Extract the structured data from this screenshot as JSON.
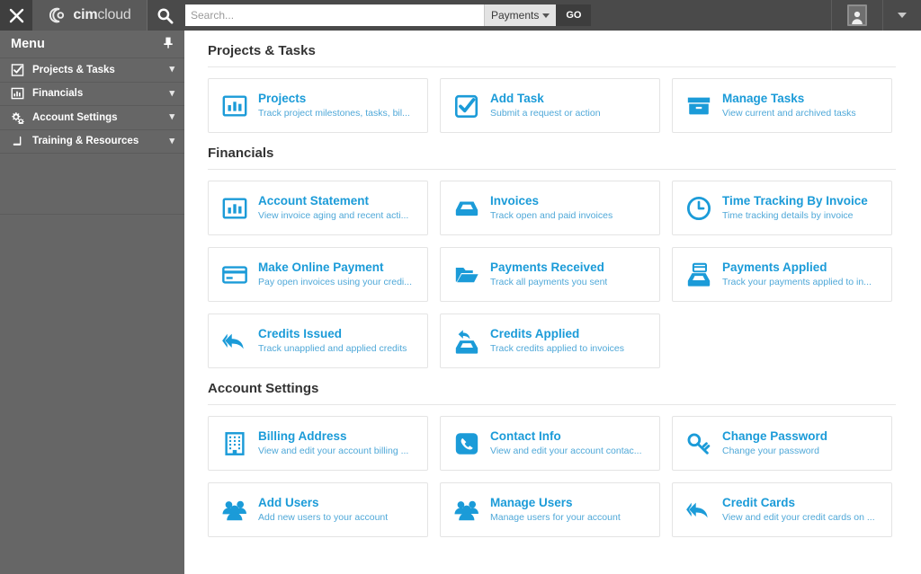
{
  "topbar": {
    "close_icon": "close-x-icon",
    "logo_bold": "cim",
    "logo_light": "cloud",
    "search_icon": "search-icon",
    "search_value": "",
    "search_placeholder": "Search...",
    "search_scope": "Payments",
    "go_label": "GO",
    "user_icon": "user-avatar-icon",
    "user_caret_icon": "chevron-down-icon",
    "colors": {
      "bar": "#4a4a4a",
      "logo_panel": "#5a5a5a",
      "go_button": "#3d3d3d"
    }
  },
  "sidebar": {
    "title": "Menu",
    "pin_icon": "pin-icon",
    "items": [
      {
        "label": "Projects & Tasks",
        "icon": "checkbox-checked-icon",
        "caret": "chevron-down-icon"
      },
      {
        "label": "Financials",
        "icon": "bar-chart-icon",
        "caret": "chevron-down-icon"
      },
      {
        "label": "Account Settings",
        "icon": "gears-icon",
        "caret": "chevron-down-icon"
      },
      {
        "label": "Training & Resources",
        "icon": "book-icon",
        "caret": "chevron-down-icon"
      }
    ],
    "colors": {
      "background": "#666666",
      "divider": "#5b5b5b",
      "text": "#ffffff"
    }
  },
  "main": {
    "accent": "#1b9bd8",
    "accent_light": "#4fa8d8",
    "sections": [
      {
        "title": "Projects & Tasks",
        "cards": [
          {
            "title": "Projects",
            "subtitle": "Track project milestones, tasks, bil...",
            "icon": "bar-chart-framed-icon"
          },
          {
            "title": "Add Task",
            "subtitle": "Submit a request or action",
            "icon": "checkbox-checked-icon"
          },
          {
            "title": "Manage Tasks",
            "subtitle": "View current and archived tasks",
            "icon": "archive-box-icon"
          }
        ]
      },
      {
        "title": "Financials",
        "cards": [
          {
            "title": "Account Statement",
            "subtitle": "View invoice aging and recent acti...",
            "icon": "bar-chart-framed-icon"
          },
          {
            "title": "Invoices",
            "subtitle": "Track open and paid invoices",
            "icon": "inbox-icon"
          },
          {
            "title": "Time Tracking By Invoice",
            "subtitle": "Time tracking details by invoice",
            "icon": "clock-icon"
          },
          {
            "title": "Make Online Payment",
            "subtitle": "Pay open invoices using your credi...",
            "icon": "credit-card-icon"
          },
          {
            "title": "Payments Received",
            "subtitle": "Track all payments you sent",
            "icon": "folder-open-icon"
          },
          {
            "title": "Payments Applied",
            "subtitle": "Track your payments applied to in...",
            "icon": "card-into-inbox-icon"
          },
          {
            "title": "Credits Issued",
            "subtitle": "Track unapplied and applied credits",
            "icon": "reply-all-arrow-icon"
          },
          {
            "title": "Credits Applied",
            "subtitle": "Track credits applied to invoices",
            "icon": "arrow-into-inbox-icon"
          }
        ]
      },
      {
        "title": "Account Settings",
        "cards": [
          {
            "title": "Billing Address",
            "subtitle": "View and edit your account billing ...",
            "icon": "building-icon"
          },
          {
            "title": "Contact Info",
            "subtitle": "View and edit your account contac...",
            "icon": "phone-icon"
          },
          {
            "title": "Change Password",
            "subtitle": "Change your password",
            "icon": "key-icon"
          },
          {
            "title": "Add Users",
            "subtitle": "Add new users to your account",
            "icon": "users-icon"
          },
          {
            "title": "Manage Users",
            "subtitle": "Manage users for your account",
            "icon": "users-icon"
          },
          {
            "title": "Credit Cards",
            "subtitle": "View and edit your credit cards on ...",
            "icon": "reply-all-arrow-icon"
          }
        ]
      }
    ]
  }
}
